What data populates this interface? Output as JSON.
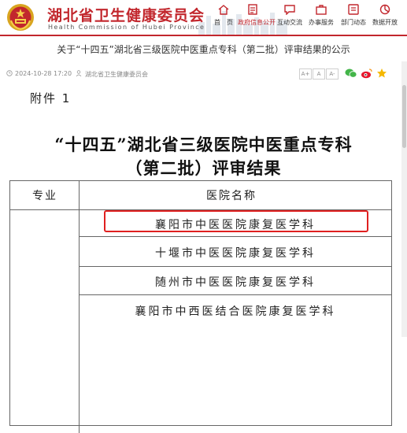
{
  "header": {
    "site_title": "湖北省卫生健康委员会",
    "site_subtitle": "Health Commission of Hubei Province",
    "brand_color": "#c2272d",
    "nav": [
      {
        "label": "首　页",
        "icon": "home-icon"
      },
      {
        "label": "政府信息公开",
        "icon": "document-icon",
        "active": true
      },
      {
        "label": "互动交流",
        "icon": "chat-icon"
      },
      {
        "label": "办事服务",
        "icon": "briefcase-icon"
      },
      {
        "label": "部门动态",
        "icon": "news-icon"
      },
      {
        "label": "数据开放",
        "icon": "chart-icon"
      }
    ]
  },
  "article": {
    "title": "关于“十四五”湖北省三级医院中医重点专科（第二批）评审结果的公示",
    "date": "2024-10-28 17:20",
    "source": "湖北省卫生健康委员会",
    "font_buttons": [
      "A+",
      "A",
      "A-"
    ],
    "share": [
      "wechat-icon",
      "weibo-icon",
      "star-icon"
    ]
  },
  "document": {
    "attachment_label": "附件 1",
    "title_line1": "“十四五”湖北省三级医院中医重点专科",
    "title_line2": "（第二批）评审结果",
    "table": {
      "col_specialty": "专业",
      "col_hospital": "医院名称",
      "rows": [
        "襄阳市中医医院康复医学科",
        "十堰市中医医院康复医学科",
        "随州市中医医院康复医学科",
        "襄阳市中西医结合医院康复医学科"
      ]
    },
    "highlight_color": "#e02020"
  }
}
